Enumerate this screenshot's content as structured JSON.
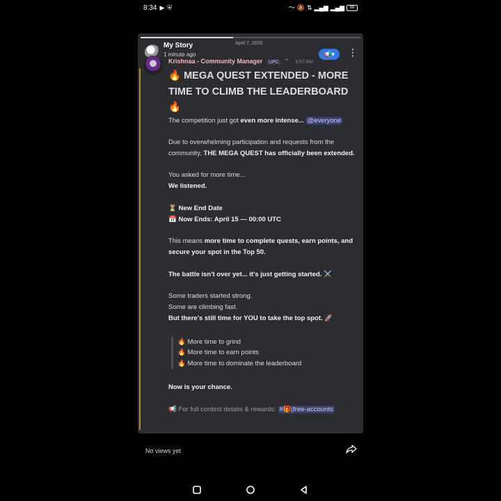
{
  "status_bar": {
    "time": "8:34",
    "left_icons": [
      "media-icon",
      "shield-icon"
    ],
    "right_icons": [
      "sound-icon",
      "mute-icon",
      "data-icon",
      "signal-icon",
      "signal-icon",
      "battery-icon"
    ],
    "battery": "88"
  },
  "story": {
    "title": "My Story",
    "time": "1 minute ago",
    "date": "April 7, 2026",
    "progress": 0.42
  },
  "message": {
    "author": "Krishnaa - Community Manager",
    "role_badge": "UPC",
    "time": "5:57 AM",
    "headline": "🔥 MEGA QUEST EXTENDED - MORE TIME TO CLIMB THE LEADERBOARD 🔥",
    "p1_pre": "The competition just got ",
    "p1_bold": "even more intense... ",
    "p1_mention": "@everyone",
    "p2_pre": "Due to overwhelming participation and requests from the community, ",
    "p2_bold": "THE MEGA QUEST has officially been extended.",
    "p3": "You asked for more time...",
    "p3_bold": "We listened.",
    "new_end_label": "⏳ New End Date",
    "now_ends": "📅 Now Ends: April 15 — 00:00 UTC",
    "p5_pre": "This means ",
    "p5_bold": "more time to complete quests, earn points, and secure your spot in the Top 50.",
    "p6_bold": "The battle isn't over yet... it's just getting started. ⚔️",
    "p7_a": "Some traders started strong.",
    "p7_b": "Some are climbing fast.",
    "p7_bold": "But there's still time for YOU to take the top spot. 🚀",
    "quote": [
      "🔥 More time to grind",
      "🔥 More time to earn points",
      "🔥 More time to dominate the leaderboard"
    ],
    "closing": "Now is your chance.",
    "footer_pre": "📢 For full contest details & rewards: ",
    "footer_channel": "#🎁|free-accounts"
  },
  "bottom": {
    "views": "No views yet"
  },
  "nav": [
    "recents-button",
    "home-button",
    "back-button"
  ]
}
